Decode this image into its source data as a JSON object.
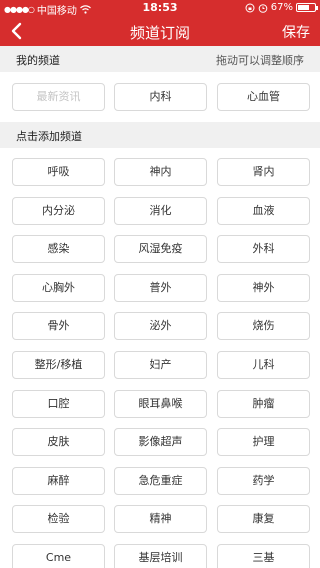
{
  "status_bar": {
    "carrier": "中国移动",
    "time": "18:53",
    "battery": "67%",
    "battery_level": 0.67,
    "icons": [
      "signal-dots-icon",
      "wifi-icon",
      "rotation-lock-icon",
      "alarm-icon",
      "battery-icon"
    ]
  },
  "nav": {
    "back_icon": "chevron-left-icon",
    "title": "频道订阅",
    "save": "保存"
  },
  "my_channels": {
    "title": "我的频道",
    "hint": "拖动可以调整顺序",
    "items": [
      {
        "label": "最新资讯",
        "disabled": true
      },
      {
        "label": "内科",
        "disabled": false
      },
      {
        "label": "心血管",
        "disabled": false
      }
    ]
  },
  "add_channels": {
    "title": "点击添加频道",
    "items": [
      "呼吸",
      "神内",
      "肾内",
      "内分泌",
      "消化",
      "血液",
      "感染",
      "风湿免疫",
      "外科",
      "心胸外",
      "普外",
      "神外",
      "骨外",
      "泌外",
      "烧伤",
      "整形/移植",
      "妇产",
      "儿科",
      "口腔",
      "眼耳鼻喉",
      "肿瘤",
      "皮肤",
      "影像超声",
      "护理",
      "麻醉",
      "急危重症",
      "药学",
      "检验",
      "精神",
      "康复",
      "Cme",
      "基层培训",
      "三基"
    ]
  },
  "colors": {
    "brand": "#d62d2d",
    "section_bg": "#f0f0f0",
    "chip_border": "#d9d9d9",
    "disabled_text": "#c4c4c4"
  }
}
